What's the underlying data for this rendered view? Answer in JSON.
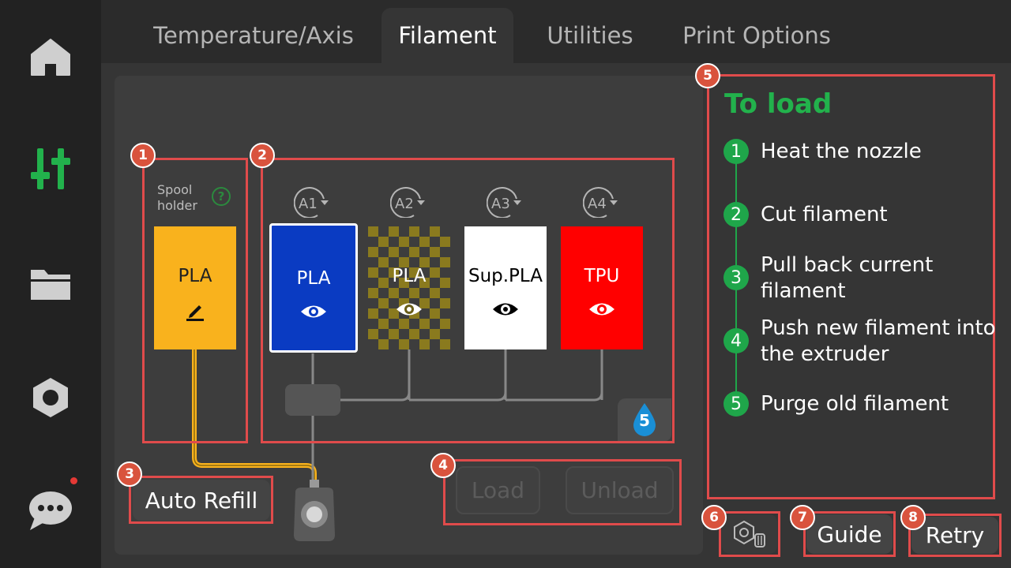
{
  "tabs": [
    {
      "label": "Temperature/Axis"
    },
    {
      "label": "Filament"
    },
    {
      "label": "Utilities"
    },
    {
      "label": "Print Options"
    }
  ],
  "sidebar": {
    "items": [
      "home-icon",
      "sliders-icon",
      "folder-icon",
      "hex-nut-icon",
      "chat-icon"
    ],
    "active_color": "#22b24c",
    "notification_dot_color": "#e53935"
  },
  "badges": [
    "1",
    "2",
    "3",
    "4",
    "5",
    "6",
    "7",
    "8"
  ],
  "spool_holder": {
    "label_line1": "Spool",
    "label_line2": "holder",
    "help": "?",
    "material": "PLA",
    "color": "#f9b21d"
  },
  "ams": {
    "slots": [
      {
        "label": "A1",
        "material": "PLA",
        "color": "#0a3bc2",
        "text_color": "#ffffff",
        "selected": true
      },
      {
        "label": "A2",
        "material": "PLA",
        "color": "#8a7a1e",
        "text_color": "#ffffff",
        "pattern": "checker"
      },
      {
        "label": "A3",
        "material": "Sup.PLA",
        "color": "#ffffff",
        "text_color": "#000000"
      },
      {
        "label": "A4",
        "material": "TPU",
        "color": "#ff0000",
        "text_color": "#ffffff"
      }
    ],
    "humidity_level": "5"
  },
  "actions": {
    "auto_refill": "Auto Refill",
    "load": "Load",
    "unload": "Unload",
    "guide": "Guide",
    "retry": "Retry"
  },
  "steps": {
    "title": "To load",
    "items": [
      {
        "num": "1",
        "text": "Heat the nozzle"
      },
      {
        "num": "2",
        "text": "Cut filament"
      },
      {
        "num": "3",
        "text": "Pull back current filament"
      },
      {
        "num": "4",
        "text": "Push new filament into the extruder"
      },
      {
        "num": "5",
        "text": "Purge old filament"
      }
    ]
  }
}
